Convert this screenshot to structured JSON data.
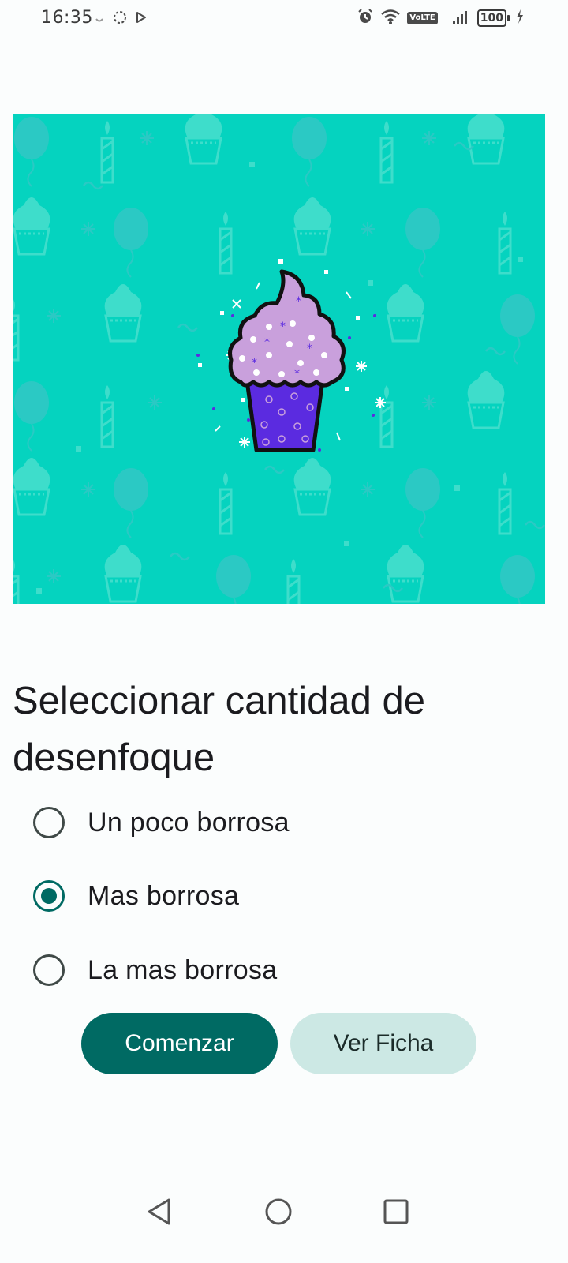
{
  "status_bar": {
    "time": "16:35",
    "volte_label": "VoLTE",
    "battery_level": "100"
  },
  "hero": {
    "image": "cupcake-pattern",
    "background_color": "#05D3BF",
    "cupcake_frosting_color": "#C9A0DC",
    "cupcake_wrapper_color": "#5B2BE0"
  },
  "main": {
    "title": "Seleccionar cantidad de desenfoque",
    "options": [
      {
        "label": "Un poco borrosa",
        "selected": false
      },
      {
        "label": "Mas borrosa",
        "selected": true
      },
      {
        "label": "La mas borrosa",
        "selected": false
      }
    ],
    "start_button_label": "Comenzar",
    "view_button_label": "Ver Ficha"
  },
  "colors": {
    "primary": "#006A63",
    "secondary_container": "#CCE8E4",
    "background": "#FBFDFD"
  },
  "nav_bar": {
    "back_icon": "triangle-back",
    "home_icon": "circle-home",
    "recents_icon": "square-recents"
  }
}
